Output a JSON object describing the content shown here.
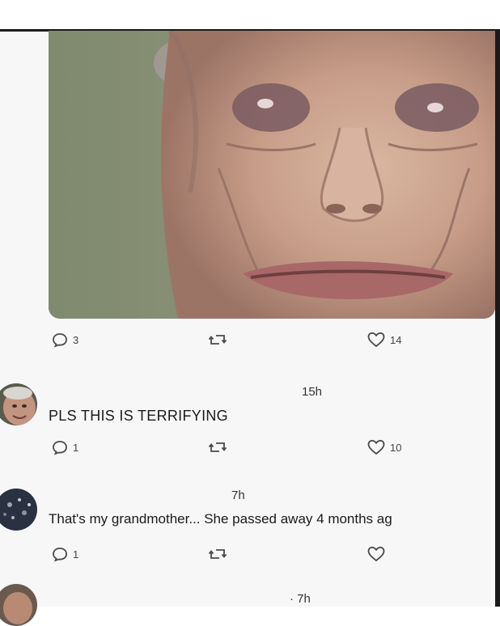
{
  "post": {
    "image_description_icon": "photo-elderly-woman-closeup",
    "actions": {
      "replies": "3",
      "likes": "14"
    }
  },
  "comments": [
    {
      "timestamp": "15h",
      "text": "PLS THIS IS TERRIFYING",
      "replies": "1",
      "likes": "10"
    },
    {
      "timestamp": "7h",
      "text": "That's my grandmother... She passed away 4 months ag",
      "replies": "1",
      "likes": ""
    },
    {
      "timestamp": "· 7h"
    }
  ],
  "colors": {
    "icon": "#4a4a4a",
    "text": "#1a1a1a",
    "background": "#f7f7f7"
  }
}
